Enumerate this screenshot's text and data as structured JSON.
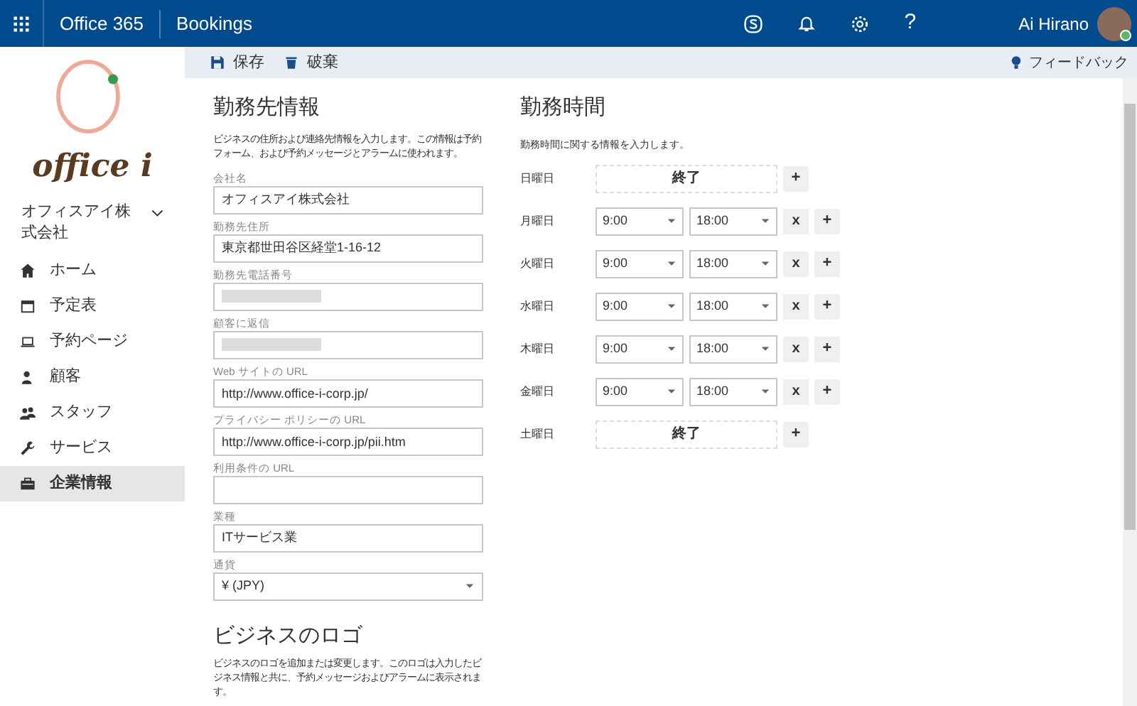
{
  "top_bar": {
    "suite": "Office 365",
    "app": "Bookings",
    "user": "Ai Hirano",
    "help": "?"
  },
  "toolbar": {
    "actions": [
      {
        "kind": "save",
        "label": "保存"
      },
      {
        "kind": "discard",
        "label": "破棄"
      }
    ],
    "feedback": "フィードバック"
  },
  "sidebar": {
    "logo_text": "office i",
    "business": "オフィスアイ株式会社",
    "items": [
      {
        "kind": "home",
        "label": "ホーム",
        "selected": false
      },
      {
        "kind": "calendar",
        "label": "予定表",
        "selected": false
      },
      {
        "kind": "laptop",
        "label": "予約ページ",
        "selected": false
      },
      {
        "kind": "customer",
        "label": "顧客",
        "selected": false
      },
      {
        "kind": "staff",
        "label": "スタッフ",
        "selected": false
      },
      {
        "kind": "wrench",
        "label": "サービス",
        "selected": false
      },
      {
        "kind": "briefcase",
        "label": "企業情報",
        "selected": true
      }
    ]
  },
  "business_info": {
    "title": "勤務先情報",
    "description": "ビジネスの住所および連絡先情報を入力します。この情報は予約フォーム、および予約メッセージとアラームに使われます。",
    "fields": [
      {
        "kind": "text",
        "label": "会社名",
        "value": "オフィスアイ株式会社"
      },
      {
        "kind": "text",
        "label": "勤務先住所",
        "value": "東京都世田谷区経堂1-16-12"
      },
      {
        "kind": "redacted",
        "label": "勤務先電話番号"
      },
      {
        "kind": "redacted",
        "label": "顧客に返信"
      },
      {
        "kind": "text",
        "label": "Web サイトの URL",
        "value": "http://www.office-i-corp.jp/"
      },
      {
        "kind": "text",
        "label": "プライバシー ポリシーの URL",
        "value": "http://www.office-i-corp.jp/pii.htm"
      },
      {
        "kind": "text",
        "label": "利用条件の URL"
      },
      {
        "kind": "text",
        "label": "業種",
        "value": "ITサービス業"
      },
      {
        "kind": "select",
        "label": "通貨",
        "value": "¥ (JPY)"
      }
    ]
  },
  "logo_section": {
    "title": "ビジネスのロゴ",
    "description": "ビジネスのロゴを追加または変更します。このロゴは入力したビジネス情報と共に、予約メッセージおよびアラームに表示されます。"
  },
  "hours": {
    "title": "勤務時間",
    "description": "勤務時間に関する情報を入力します。",
    "days": [
      {
        "day": "日曜日",
        "closed": true,
        "status": "終了"
      },
      {
        "day": "月曜日",
        "closed": false,
        "start": "9:00",
        "end": "18:00",
        "remove": "x",
        "add": "+"
      },
      {
        "day": "火曜日",
        "closed": false,
        "start": "9:00",
        "end": "18:00",
        "remove": "x",
        "add": "+"
      },
      {
        "day": "水曜日",
        "closed": false,
        "start": "9:00",
        "end": "18:00",
        "remove": "x",
        "add": "+"
      },
      {
        "day": "木曜日",
        "closed": false,
        "start": "9:00",
        "end": "18:00",
        "remove": "x",
        "add": "+"
      },
      {
        "day": "金曜日",
        "closed": false,
        "start": "9:00",
        "end": "18:00",
        "remove": "x",
        "add": "+"
      },
      {
        "day": "土曜日",
        "closed": true,
        "status": "終了"
      }
    ],
    "add_closed": "+"
  }
}
